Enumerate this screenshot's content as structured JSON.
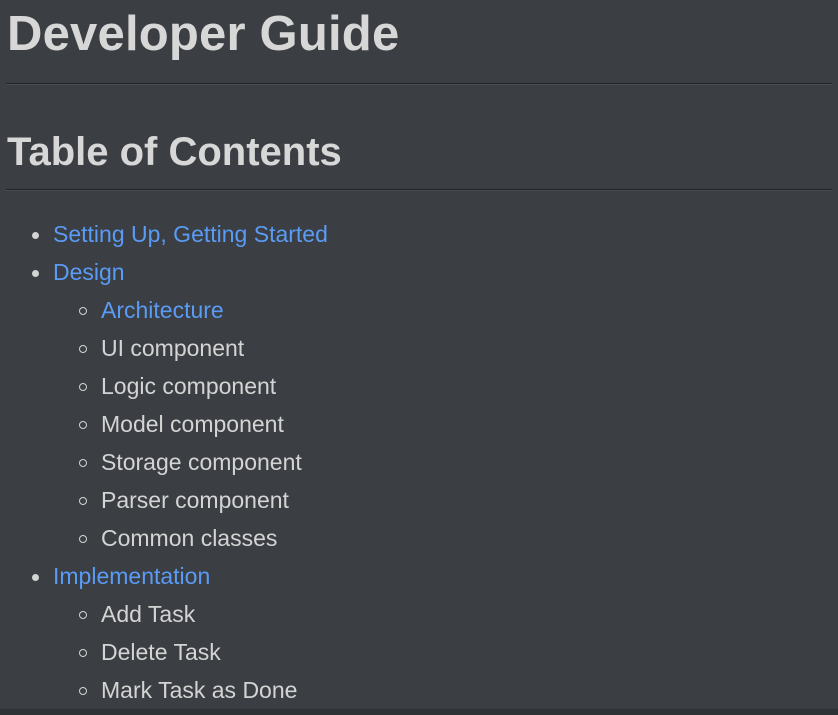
{
  "page": {
    "title": "Developer Guide",
    "toc_heading": "Table of Contents"
  },
  "toc": {
    "items": [
      {
        "label": "Setting Up, Getting Started",
        "is_link": true
      },
      {
        "label": "Design",
        "is_link": true
      },
      {
        "label": "Architecture",
        "is_link": true
      },
      {
        "label": "UI component",
        "is_link": false
      },
      {
        "label": "Logic component",
        "is_link": false
      },
      {
        "label": "Model component",
        "is_link": false
      },
      {
        "label": "Storage component",
        "is_link": false
      },
      {
        "label": "Parser component",
        "is_link": false
      },
      {
        "label": "Common classes",
        "is_link": false
      },
      {
        "label": "Implementation",
        "is_link": true
      },
      {
        "label": "Add Task",
        "is_link": false
      },
      {
        "label": "Delete Task",
        "is_link": false
      },
      {
        "label": "Mark Task as Done",
        "is_link": false
      }
    ]
  },
  "colors": {
    "background": "#3b3e42",
    "text": "#d4d4d4",
    "link": "#5a9bf5"
  }
}
